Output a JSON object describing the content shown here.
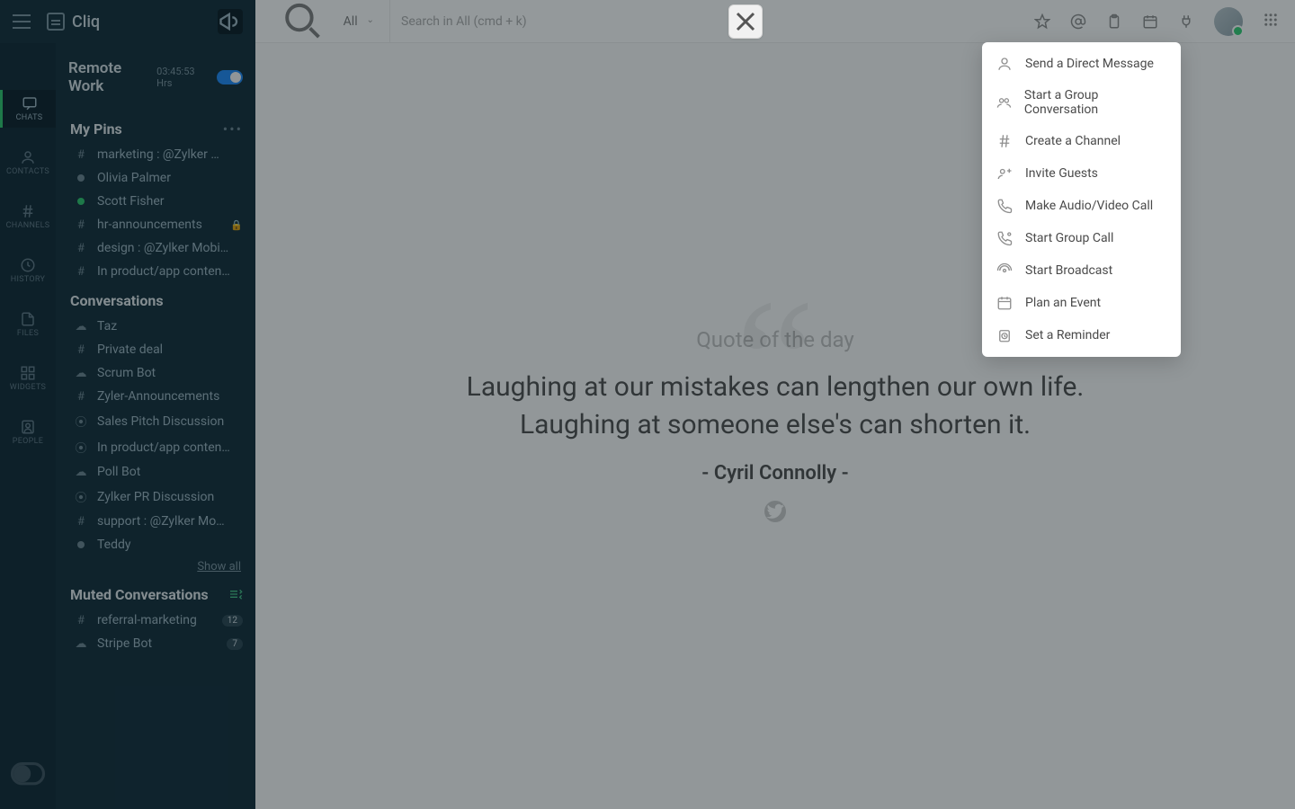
{
  "brand": {
    "name": "Cliq"
  },
  "remote": {
    "title": "Remote Work",
    "time": "03:45:53 Hrs"
  },
  "rail": {
    "items": [
      {
        "label": "CHATS",
        "active": true
      },
      {
        "label": "CONTACTS",
        "active": false
      },
      {
        "label": "CHANNELS",
        "active": false
      },
      {
        "label": "HISTORY",
        "active": false
      },
      {
        "label": "FILES",
        "active": false
      },
      {
        "label": "WIDGETS",
        "active": false
      },
      {
        "label": "PEOPLE",
        "active": false
      }
    ]
  },
  "pins": {
    "title": "My Pins",
    "items": [
      {
        "icon": "hash",
        "label": "marketing : @Zylker …"
      },
      {
        "icon": "presence-offline",
        "label": "Olivia Palmer"
      },
      {
        "icon": "presence-online",
        "label": "Scott Fisher"
      },
      {
        "icon": "hash",
        "label": "hr-announcements",
        "lock": true
      },
      {
        "icon": "hash",
        "label": "design : @Zylker Mobi…"
      },
      {
        "icon": "hash",
        "label": "In product/app conten…"
      }
    ]
  },
  "convos": {
    "title": "Conversations",
    "items": [
      {
        "icon": "bot",
        "label": "Taz"
      },
      {
        "icon": "hash",
        "label": "Private deal"
      },
      {
        "icon": "bot",
        "label": "Scrum Bot"
      },
      {
        "icon": "hash",
        "label": "Zyler-Announcements"
      },
      {
        "icon": "group",
        "label": "Sales Pitch Discussion"
      },
      {
        "icon": "group",
        "label": "In product/app conten…"
      },
      {
        "icon": "bot",
        "label": "Poll Bot"
      },
      {
        "icon": "group",
        "label": "Zylker PR Discussion"
      },
      {
        "icon": "hash",
        "label": "support : @Zylker Mo…"
      },
      {
        "icon": "presence-offline",
        "label": "Teddy"
      }
    ],
    "show_all": "Show all"
  },
  "muted": {
    "title": "Muted Conversations",
    "items": [
      {
        "icon": "hash",
        "label": "referral-marketing",
        "badge": "12"
      },
      {
        "icon": "bot",
        "label": "Stripe Bot",
        "badge": "7"
      }
    ]
  },
  "search": {
    "scope": "All",
    "placeholder": "Search in All (cmd + k)"
  },
  "quote": {
    "label": "Quote of the day",
    "text": "Laughing at our mistakes can lengthen our own life. Laughing at someone else's can shorten it.",
    "author": "Cyril Connolly"
  },
  "menu": {
    "items": [
      {
        "icon": "user",
        "label": "Send a Direct Message"
      },
      {
        "icon": "group",
        "label": "Start a Group Conversation"
      },
      {
        "icon": "hash",
        "label": "Create a Channel"
      },
      {
        "icon": "invite",
        "label": "Invite Guests"
      },
      {
        "icon": "phone",
        "label": "Make Audio/Video Call"
      },
      {
        "icon": "phone-group",
        "label": "Start Group Call"
      },
      {
        "icon": "broadcast",
        "label": "Start Broadcast"
      },
      {
        "icon": "calendar",
        "label": "Plan an Event"
      },
      {
        "icon": "reminder",
        "label": "Set a Reminder"
      }
    ]
  }
}
